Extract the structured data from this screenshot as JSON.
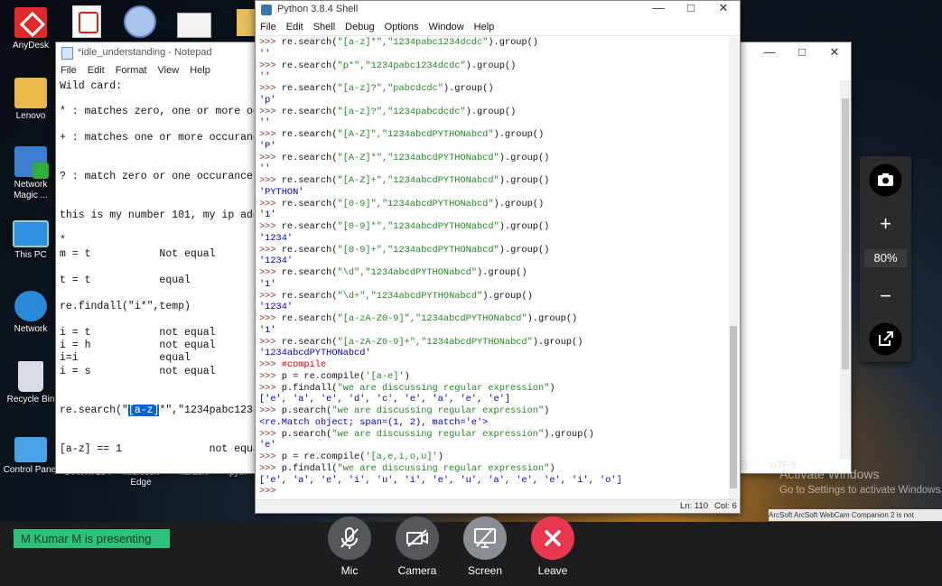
{
  "desktop": {
    "icons": [
      {
        "label": "AnyDesk"
      },
      {
        "label": "Lenovo"
      },
      {
        "label": "Network Magic ..."
      },
      {
        "label": "This PC"
      },
      {
        "label": "Network"
      },
      {
        "label": "Recycle Bin"
      },
      {
        "label": "Control Panel"
      }
    ],
    "taskbar_labels": [
      "SVWK7194",
      "Microsoft Edge",
      "karachi",
      "pyth"
    ]
  },
  "notepad": {
    "title": "*idle_understanding - Notepad",
    "menu": [
      "File",
      "Edit",
      "Format",
      "View",
      "Help"
    ],
    "lines": [
      "Wild card:",
      "* : matches zero, one or more occu",
      "+ : matches one or more occurances",
      "? : match zero or one occurance of",
      "this is my number 101, my ip addre",
      "*",
      "m = t           Not equal",
      "t = t           equal",
      "re.findall(\"i*\",temp)",
      "i = t           not equal",
      "i = h           not equal",
      "i=i             equal",
      "i = s           not equal",
      "re.search(\"",
      "[a-z]",
      "*\",\"1234pabc1234dc",
      "[a-z] == 1              not equal"
    ]
  },
  "shell": {
    "title": "Python 3.8.4 Shell",
    "menu": [
      "File",
      "Edit",
      "Shell",
      "Debug",
      "Options",
      "Window",
      "Help"
    ],
    "lines": [
      {
        "p": ">>> ",
        "c": "re.search(",
        "s": "\"[a-z]*\",\"1234pabc1234dcdc\"",
        "e": ").group()"
      },
      {
        "o": "''"
      },
      {
        "p": ">>> ",
        "c": "re.search(",
        "s": "\"p*\",\"1234pabc1234dcdc\"",
        "e": ").group()"
      },
      {
        "o": "''"
      },
      {
        "p": ">>> ",
        "c": "re.search(",
        "s": "\"[a-z]?\",\"pabcdcdc\"",
        "e": ").group()"
      },
      {
        "o": "'p'"
      },
      {
        "p": ">>> ",
        "c": "re.search(",
        "s": "\"[a-z]?\",\"1234pabcdcdc\"",
        "e": ").group()"
      },
      {
        "o": "''"
      },
      {
        "p": ">>> ",
        "c": "re.search(",
        "s": "\"[A-Z]\",\"1234abcdPYTHONabcd\"",
        "e": ").group()"
      },
      {
        "o": "'P'"
      },
      {
        "p": ">>> ",
        "c": "re.search(",
        "s": "\"[A-Z]*\",\"1234abcdPYTHONabcd\"",
        "e": ").group()"
      },
      {
        "o": "''"
      },
      {
        "p": ">>> ",
        "c": "re.search(",
        "s": "\"[A-Z]+\",\"1234abcdPYTHONabcd\"",
        "e": ").group()"
      },
      {
        "o": "'PYTHON'"
      },
      {
        "p": ">>> ",
        "c": "re.search(",
        "s": "\"[0-9]\",\"1234abcdPYTHONabcd\"",
        "e": ").group()"
      },
      {
        "o": "'1'"
      },
      {
        "p": ">>> ",
        "c": "re.search(",
        "s": "\"[0-9]*\",\"1234abcdPYTHONabcd\"",
        "e": ").group()"
      },
      {
        "o": "'1234'"
      },
      {
        "p": ">>> ",
        "c": "re.search(",
        "s": "\"[0-9]+\",\"1234abcdPYTHONabcd\"",
        "e": ").group()"
      },
      {
        "o": "'1234'"
      },
      {
        "p": ">>> ",
        "c": "re.search(",
        "s": "\"\\d\",\"1234abcdPYTHONabcd\"",
        "e": ").group()"
      },
      {
        "o": "'1'"
      },
      {
        "p": ">>> ",
        "c": "re.search(",
        "s": "\"\\d+\",\"1234abcdPYTHONabcd\"",
        "e": ").group()"
      },
      {
        "o": "'1234'"
      },
      {
        "p": ">>> ",
        "c": "re.search(",
        "s": "\"[a-zA-Z0-9]\",\"1234abcdPYTHONabcd\"",
        "e": ").group()"
      },
      {
        "o": "'1'"
      },
      {
        "p": ">>> ",
        "c": "re.search(",
        "s": "\"[a-zA-Z0-9]+\",\"1234abcdPYTHONabcd\"",
        "e": ").group()"
      },
      {
        "o": "'1234abcdPYTHONabcd'"
      },
      {
        "p": ">>> ",
        "m": "#compile"
      },
      {
        "p": ">>> ",
        "c": "p = re.compile(",
        "s": "'[a-e]'",
        "e": ")"
      },
      {
        "p": ">>> ",
        "c": "p.findall(",
        "s": "\"we are discussing regular expression\"",
        "e": ")"
      },
      {
        "o": "['e', 'a', 'e', 'd', 'c', 'e', 'a', 'e', 'e']"
      },
      {
        "p": ">>> ",
        "c": "p.search(",
        "s": "\"we are discussing regular expression\"",
        "e": ")"
      },
      {
        "o": "<re.Match object; span=(1, 2), match='e'>"
      },
      {
        "p": ">>> ",
        "c": "p.search(",
        "s": "\"we are discussing regular expression\"",
        "e": ").group()"
      },
      {
        "o": "'e'"
      },
      {
        "p": ">>> ",
        "c": "p = re.compile(",
        "s": "'[a,e,i,o,u]'",
        "e": ")"
      },
      {
        "p": ">>> ",
        "c": "p.findall(",
        "s": "\"we are discussing regular expression\"",
        "e": ")"
      },
      {
        "o": "['e', 'a', 'e', 'i', 'u', 'i', 'e', 'u', 'a', 'e', 'e', 'i', 'o']"
      },
      {
        "p": ">>> "
      }
    ],
    "status_ln": "Ln: 110",
    "status_col": "Col: 6"
  },
  "right_status": {
    "paren": "F)",
    "encoding": "UTF-8"
  },
  "watermark": {
    "line1": "Activate Windows",
    "line2": "Go to Settings to activate Windows."
  },
  "arcsoft_text": "ArcSoft  ArcSoft WebCam Companion 2 is not",
  "zoom": {
    "level": "80%"
  },
  "meeting": {
    "presenter_text": "M  Kumar M is presenting",
    "buttons": [
      {
        "label": "Mic"
      },
      {
        "label": "Camera"
      },
      {
        "label": "Screen"
      },
      {
        "label": "Leave"
      }
    ],
    "colors": {
      "leave": "#e8384f",
      "presenter_badge": "#2dc27a",
      "buttons": "#55575c"
    }
  }
}
